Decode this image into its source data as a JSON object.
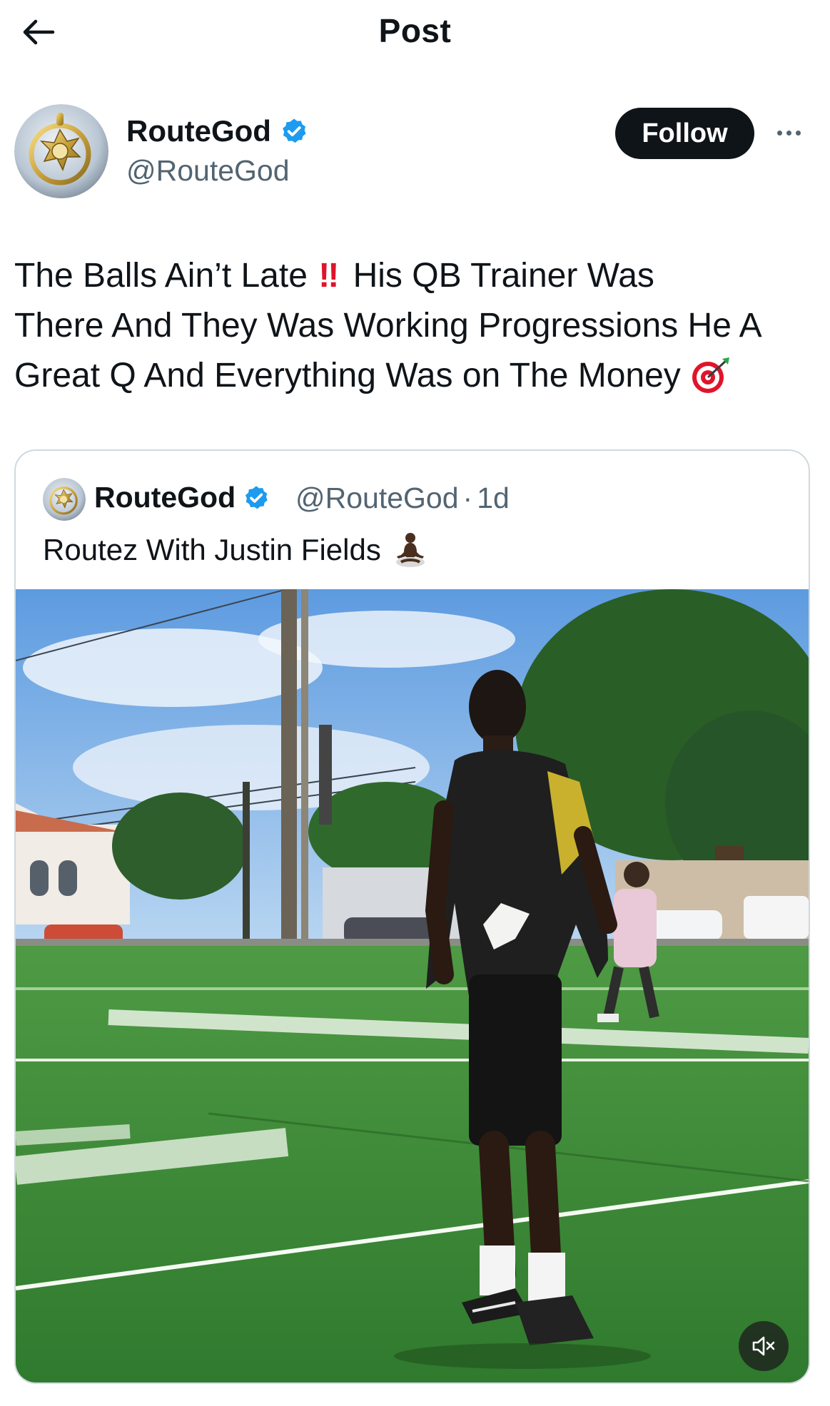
{
  "header": {
    "title": "Post",
    "back_icon": "arrow-left-icon"
  },
  "author": {
    "name": "RouteGod",
    "handle": "@RouteGod",
    "verified": true,
    "verified_color": "#1d9bf0",
    "follow_label": "Follow",
    "more_icon": "more-horizontal-icon"
  },
  "post": {
    "line1_a": "The Balls Ain’t Late",
    "line1_emoji": "‼",
    "line1_b": "His QB Trainer Was",
    "line2": "There And They Was Working Progressions He A",
    "line3": "Great Q And Everything Was on The Money",
    "line3_emoji": "target-icon"
  },
  "quote": {
    "name": "RouteGod",
    "handle": "@RouteGod",
    "separator": "·",
    "time": "1d",
    "text": "Routez With Justin Fields",
    "text_emoji": "person-meditating-icon",
    "media_type": "video",
    "mute_icon": "volume-muted-icon"
  },
  "colors": {
    "text": "#0f1419",
    "secondary": "#536471",
    "border": "#cfd9de",
    "follow_bg": "#0f1419",
    "accent": "#1d9bf0",
    "emoji_red": "#e0142a"
  }
}
